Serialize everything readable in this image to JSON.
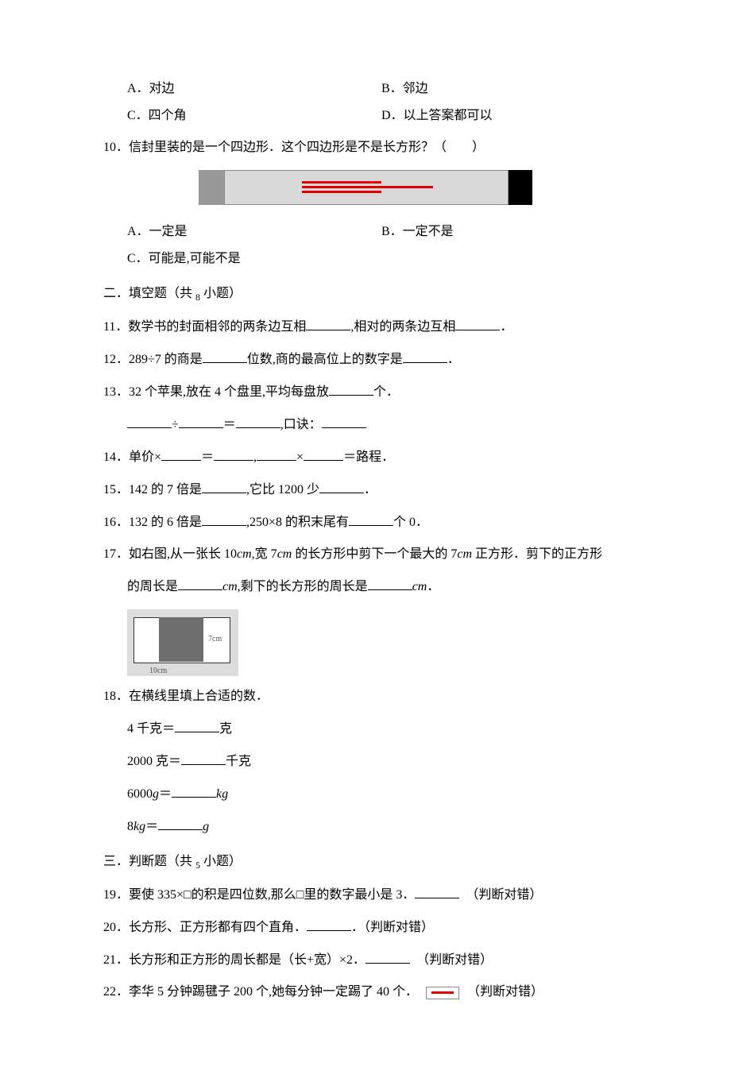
{
  "q9": {
    "optA": "A．对边",
    "optB": "B．邻边",
    "optC": "C．四个角",
    "optD": "D．以上答案都可以"
  },
  "q10": {
    "stem": "10．信封里装的是一个四边形．这个四边形是不是长方形？（　　）",
    "optA": "A．一定是",
    "optB": "B．一定不是",
    "optC": "C．可能是,可能不是"
  },
  "section2": {
    "title_a": "二．填空题（共 ",
    "title_n": "8",
    "title_b": " 小题）"
  },
  "q11": {
    "a": "11．数学书的封面相邻的两条边互相",
    "b": ",相对的两条边互相",
    "c": "．"
  },
  "q12": {
    "a": "12．289÷7 的商是",
    "b": "位数,商的最高位上的数字是",
    "c": "．"
  },
  "q13": {
    "a": "13．32 个苹果,放在 4 个盘里,平均每盘放",
    "b": "个．",
    "c1": "÷",
    "c2": "＝",
    "c3": ",口诀：",
    "c4": ""
  },
  "q14": {
    "a": "14．单价×",
    "b": "＝",
    "c": ",",
    "d": "×",
    "e": "＝路程．"
  },
  "q15": {
    "a": "15．142 的 7 倍是",
    "b": ",它比 1200 少",
    "c": "．"
  },
  "q16": {
    "a": "16．132 的 6 倍是",
    "b": ",250×8 的积末尾有",
    "c": "个 0．"
  },
  "q17": {
    "a": "17．如右图,从一张长 10",
    "cm1": "cm",
    "b": ",宽 7",
    "cm2": "cm",
    "c": " 的长方形中剪下一个最大的 7",
    "cm3": "cm",
    "d": " 正方形．剪下的正方形",
    "e": "的周长是",
    "cm4": "cm",
    "f": ",剩下的长方形的周长是",
    "cm5": "cm",
    "g": "．",
    "label7": "7cm",
    "label10": "10cm"
  },
  "q18": {
    "stem": "18．在横线里填上合适的数．",
    "l1a": "4 千克＝",
    "l1b": "克",
    "l2a": "2000 克＝",
    "l2b": "千克",
    "l3a": "6000",
    "l3g": "g",
    "l3eq": "＝",
    "l3kg": "kg",
    "l4a": "8",
    "l4kg": "kg",
    "l4eq": "＝",
    "l4g": "g"
  },
  "section3": {
    "title_a": "三．判断题（共 ",
    "title_n": "5",
    "title_b": " 小题）"
  },
  "q19": {
    "a": "19．要使 335×□的积是四位数,那么□里的数字最小是 3．",
    "tf": "（判断对错）"
  },
  "q20": {
    "a": "20．长方形、正方形都有四个直角．",
    "b": "．（判断对错）"
  },
  "q21": {
    "a": "21．长方形和正方形的周长都是（长+宽）×2．",
    "tf": "（判断对错）"
  },
  "q22": {
    "a": "22．李华 5 分钟踢毽子 200 个,她每分钟一定踢了 40 个．",
    "tf": "（判断对错）"
  }
}
